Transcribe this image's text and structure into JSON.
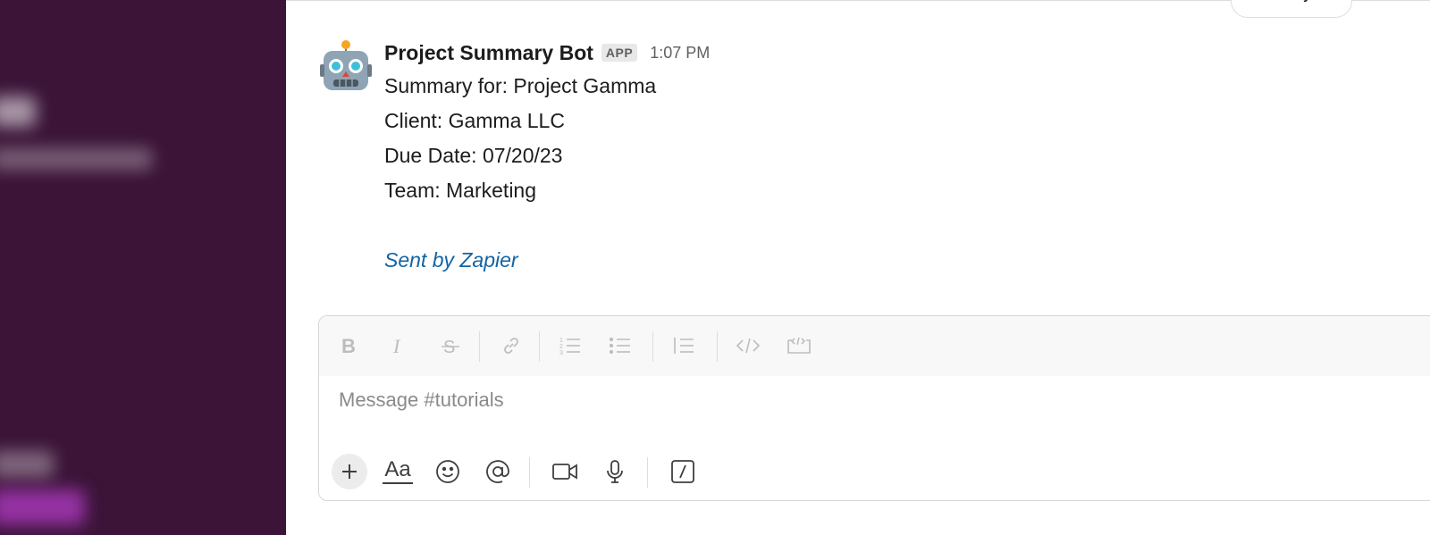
{
  "date_divider": {
    "label": "Today"
  },
  "message": {
    "sender": "Project Summary Bot",
    "badge": "APP",
    "timestamp": "1:07 PM",
    "lines": [
      "Summary for: Project Gamma",
      "Client: Gamma LLC",
      "Due Date: 07/20/23",
      "Team: Marketing"
    ],
    "footer": "Sent by Zapier",
    "avatar_icon": "robot-face-icon"
  },
  "composer": {
    "placeholder": "Message #tutorials",
    "value": "",
    "format_buttons": [
      "bold-icon",
      "italic-icon",
      "strikethrough-icon",
      "link-icon",
      "ordered-list-icon",
      "bulleted-list-icon",
      "blockquote-icon",
      "code-icon",
      "code-block-icon"
    ],
    "aa_label": "Aa",
    "action_buttons": [
      "plus-icon",
      "formatting-icon",
      "emoji-icon",
      "mention-icon",
      "video-icon",
      "microphone-icon",
      "slash-command-icon"
    ]
  },
  "colors": {
    "sidebar": "#3b1438",
    "link": "#1264a3",
    "text": "#1d1c1d",
    "muted": "#616061"
  }
}
